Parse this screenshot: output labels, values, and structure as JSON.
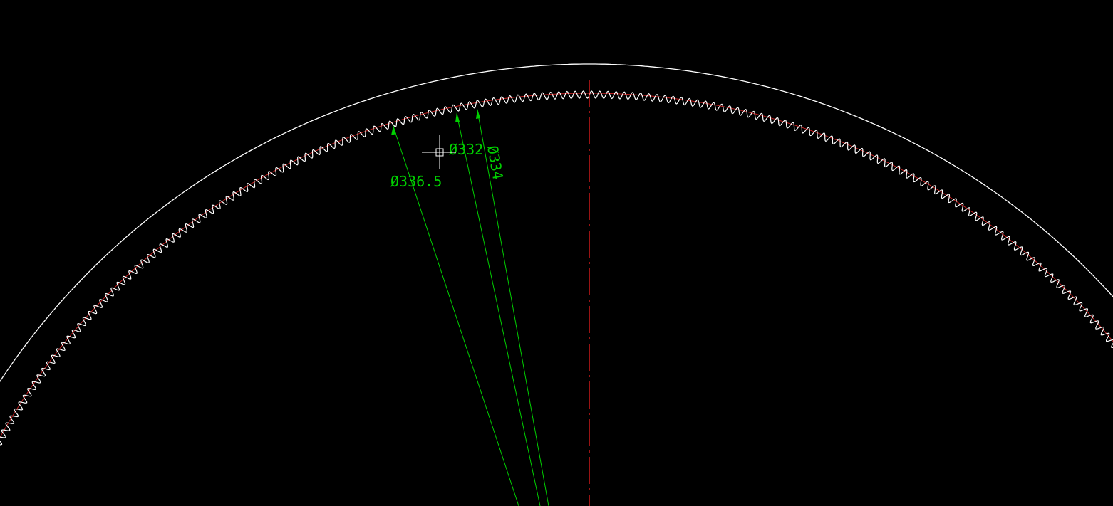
{
  "colors": {
    "background": "#000000",
    "outline": "#ffffff",
    "teeth": "#ffffff",
    "teeth_base": "#c42020",
    "centerline": "#ff2020",
    "dimension": "#00d000",
    "cursor": "#ffffff"
  },
  "dimensions": [
    {
      "label": "Ø336.5"
    },
    {
      "label": "Ø332"
    },
    {
      "label": "Ø334"
    }
  ],
  "drawing": {
    "object": "internal gear profile",
    "centerline_style": "dash-dot",
    "cursor": "crosshair-with-pickbox"
  }
}
